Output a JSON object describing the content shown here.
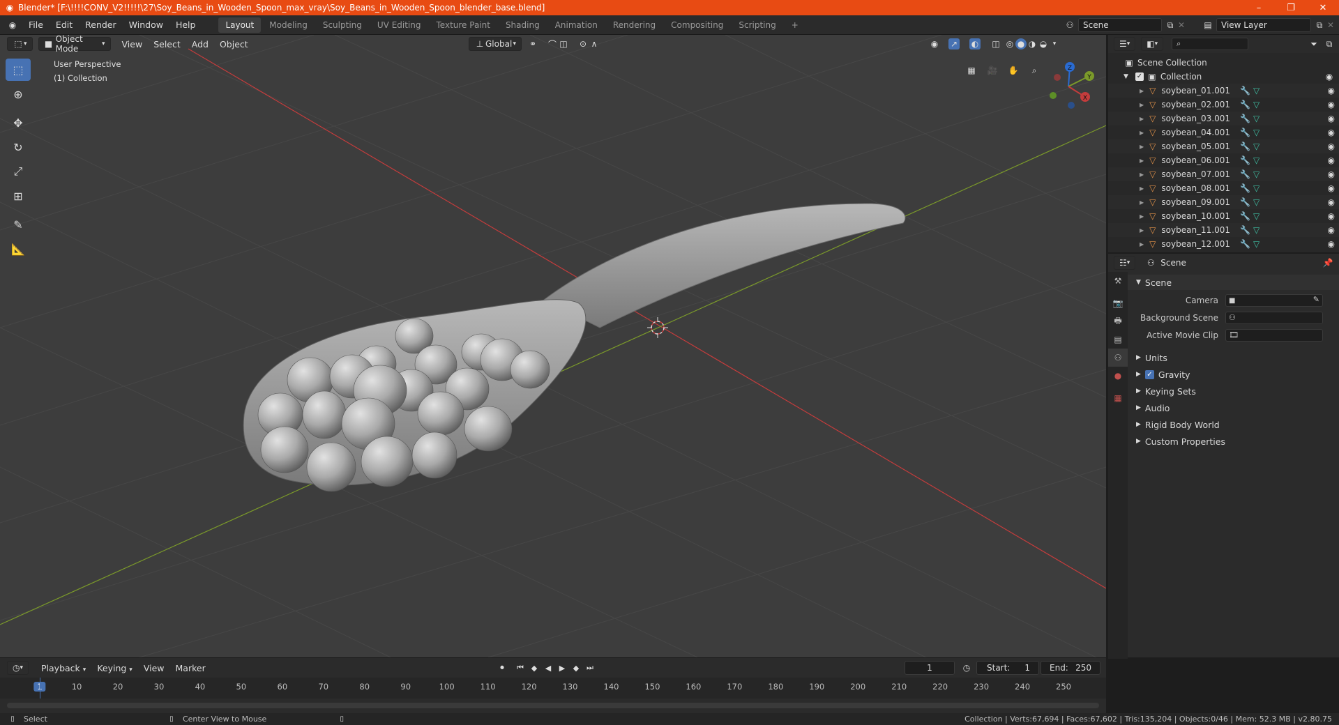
{
  "titlebar": {
    "title": "Blender* [F:\\!!!!CONV_V2!!!!!\\27\\Soy_Beans_in_Wooden_Spoon_max_vray\\Soy_Beans_in_Wooden_Spoon_blender_base.blend]",
    "minimize": "–",
    "maximize": "❐",
    "close": "✕"
  },
  "topbar": {
    "menus": [
      "File",
      "Edit",
      "Render",
      "Window",
      "Help"
    ],
    "workspaces": [
      "Layout",
      "Modeling",
      "Sculpting",
      "UV Editing",
      "Texture Paint",
      "Shading",
      "Animation",
      "Rendering",
      "Compositing",
      "Scripting"
    ],
    "add_tab": "+",
    "scene": "Scene",
    "view_layer": "View Layer"
  },
  "viewport": {
    "mode": "Object Mode",
    "menus": [
      "View",
      "Select",
      "Add",
      "Object"
    ],
    "transform": "Global",
    "perspective_label": "User Perspective",
    "collection_label": "(1) Collection",
    "gizmo_axes": {
      "x": "X",
      "y": "Y",
      "z": "Z"
    }
  },
  "outliner": {
    "search_placeholder": "",
    "scene_collection": "Scene Collection",
    "collection": "Collection",
    "objects": [
      "soybean_01.001",
      "soybean_02.001",
      "soybean_03.001",
      "soybean_04.001",
      "soybean_05.001",
      "soybean_06.001",
      "soybean_07.001",
      "soybean_08.001",
      "soybean_09.001",
      "soybean_10.001",
      "soybean_11.001",
      "soybean_12.001"
    ]
  },
  "properties": {
    "header": "Scene",
    "panel": "Scene",
    "camera_label": "Camera",
    "background_scene_label": "Background Scene",
    "active_movie_clip_label": "Active Movie Clip",
    "sections": [
      "Units",
      "Gravity",
      "Keying Sets",
      "Audio",
      "Rigid Body World",
      "Custom Properties"
    ],
    "gravity_checked": true
  },
  "timeline": {
    "menus": [
      "Playback",
      "Keying",
      "View",
      "Marker"
    ],
    "current_frame": "1",
    "start_label": "Start:",
    "start": "1",
    "end_label": "End:",
    "end": "250",
    "ticks": [
      "1",
      "10",
      "20",
      "30",
      "40",
      "50",
      "60",
      "70",
      "80",
      "90",
      "100",
      "110",
      "120",
      "130",
      "140",
      "150",
      "160",
      "170",
      "180",
      "190",
      "200",
      "210",
      "220",
      "230",
      "240",
      "250"
    ]
  },
  "statusbar": {
    "select": "Select",
    "center_view": "Center View to Mouse",
    "stats": "Collection | Verts:67,694 | Faces:67,602 | Tris:135,204 | Objects:0/46 | Mem: 52.3 MB | v2.80.75"
  },
  "colors": {
    "titlebar": "#e84b13",
    "accent": "#4772b3",
    "x_axis": "#c43c3c",
    "y_axis": "#7b9a2a",
    "viewport_bg": "#3d3d3d"
  }
}
